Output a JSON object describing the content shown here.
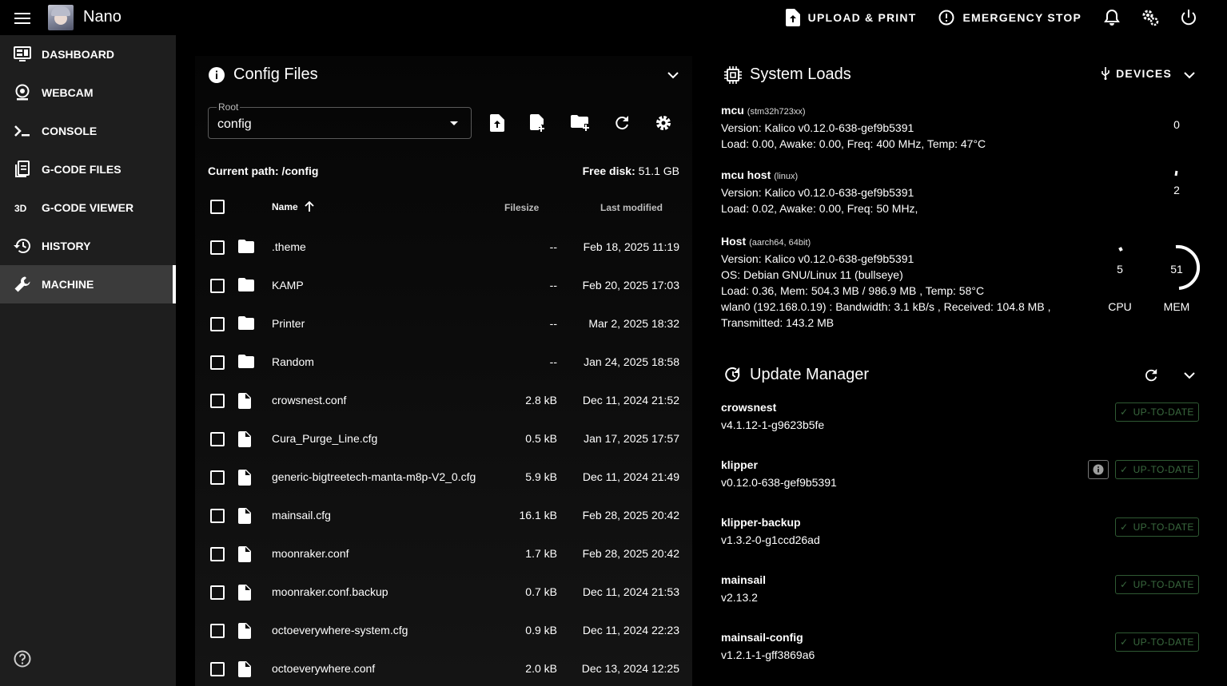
{
  "header": {
    "app_title": "Nano",
    "upload_print": "UPLOAD & PRINT",
    "emergency_stop": "EMERGENCY STOP"
  },
  "sidebar": {
    "items": [
      {
        "label": "DASHBOARD",
        "icon": "monitor-dashboard-icon"
      },
      {
        "label": "WEBCAM",
        "icon": "webcam-icon"
      },
      {
        "label": "CONSOLE",
        "icon": "console-icon"
      },
      {
        "label": "G-CODE FILES",
        "icon": "file-document-icon"
      },
      {
        "label": "G-CODE VIEWER",
        "icon": "3d-icon"
      },
      {
        "label": "HISTORY",
        "icon": "history-icon"
      },
      {
        "label": "MACHINE",
        "icon": "wrench-icon",
        "active": true
      }
    ]
  },
  "config_files": {
    "title": "Config Files",
    "root_label": "Root",
    "root_value": "config",
    "current_path_label": "Current path: /config",
    "free_disk_label": "Free disk:",
    "free_disk_value": "51.1 GB",
    "columns": {
      "name": "Name",
      "filesize": "Filesize",
      "last_modified": "Last modified"
    },
    "files": [
      {
        "name": ".theme",
        "type": "folder",
        "size": "--",
        "modified": "Feb 18, 2025 11:19"
      },
      {
        "name": "KAMP",
        "type": "folder",
        "size": "--",
        "modified": "Feb 20, 2025 17:03"
      },
      {
        "name": "Printer",
        "type": "folder",
        "size": "--",
        "modified": "Mar 2, 2025 18:32"
      },
      {
        "name": "Random",
        "type": "folder",
        "size": "--",
        "modified": "Jan 24, 2025 18:58"
      },
      {
        "name": "crowsnest.conf",
        "type": "file",
        "size": "2.8 kB",
        "modified": "Dec 11, 2024 21:52"
      },
      {
        "name": "Cura_Purge_Line.cfg",
        "type": "file",
        "size": "0.5 kB",
        "modified": "Jan 17, 2025 17:57"
      },
      {
        "name": "generic-bigtreetech-manta-m8p-V2_0.cfg",
        "type": "file",
        "size": "5.9 kB",
        "modified": "Dec 11, 2024 21:49"
      },
      {
        "name": "mainsail.cfg",
        "type": "file",
        "size": "16.1 kB",
        "modified": "Feb 28, 2025 20:42"
      },
      {
        "name": "moonraker.conf",
        "type": "file",
        "size": "1.7 kB",
        "modified": "Feb 28, 2025 20:42"
      },
      {
        "name": "moonraker.conf.backup",
        "type": "file",
        "size": "0.7 kB",
        "modified": "Dec 11, 2024 21:53"
      },
      {
        "name": "octoeverywhere-system.cfg",
        "type": "file",
        "size": "0.9 kB",
        "modified": "Dec 11, 2024 22:23"
      },
      {
        "name": "octoeverywhere.conf",
        "type": "file",
        "size": "2.0 kB",
        "modified": "Dec 13, 2024 12:25"
      }
    ]
  },
  "system_loads": {
    "title": "System Loads",
    "devices_label": "DEVICES",
    "mcus": [
      {
        "name": "mcu",
        "chip": "(stm32h723xx)",
        "lines": [
          "Version: Kalico v0.12.0-638-gef9b5391",
          "Load: 0.00, Awake: 0.00, Freq: 400 MHz, Temp: 47°C"
        ],
        "gauge": "0"
      },
      {
        "name": "mcu host",
        "chip": "(linux)",
        "lines": [
          "Version: Kalico v0.12.0-638-gef9b5391",
          "Load: 0.02, Awake: 0.00, Freq: 50 MHz,"
        ],
        "gauge": "2"
      }
    ],
    "host": {
      "name": "Host",
      "chip": "(aarch64, 64bit)",
      "lines": [
        "Version: Kalico v0.12.0-638-gef9b5391",
        "OS: Debian GNU/Linux 11 (bullseye)",
        "Load: 0.36, Mem: 504.3 MB / 986.9 MB , Temp: 58°C",
        "wlan0 (192.168.0.19) : Bandwidth: 3.1 kB/s , Received: 104.8 MB ,",
        "Transmitted: 143.2 MB"
      ],
      "cpu_value": "5",
      "cpu_label": "CPU",
      "mem_value": "51",
      "mem_label": "MEM"
    }
  },
  "update_manager": {
    "title": "Update Manager",
    "status_label": "UP-TO-DATE",
    "items": [
      {
        "name": "crowsnest",
        "version": "v4.1.12-1-g9623b5fe"
      },
      {
        "name": "klipper",
        "version": "v0.12.0-638-gef9b5391"
      },
      {
        "name": "klipper-backup",
        "version": "v1.3.2-0-g1ccd26ad"
      },
      {
        "name": "mainsail",
        "version": "v2.13.2"
      },
      {
        "name": "mainsail-config",
        "version": "v1.2.1-1-gff3869a6"
      }
    ]
  }
}
